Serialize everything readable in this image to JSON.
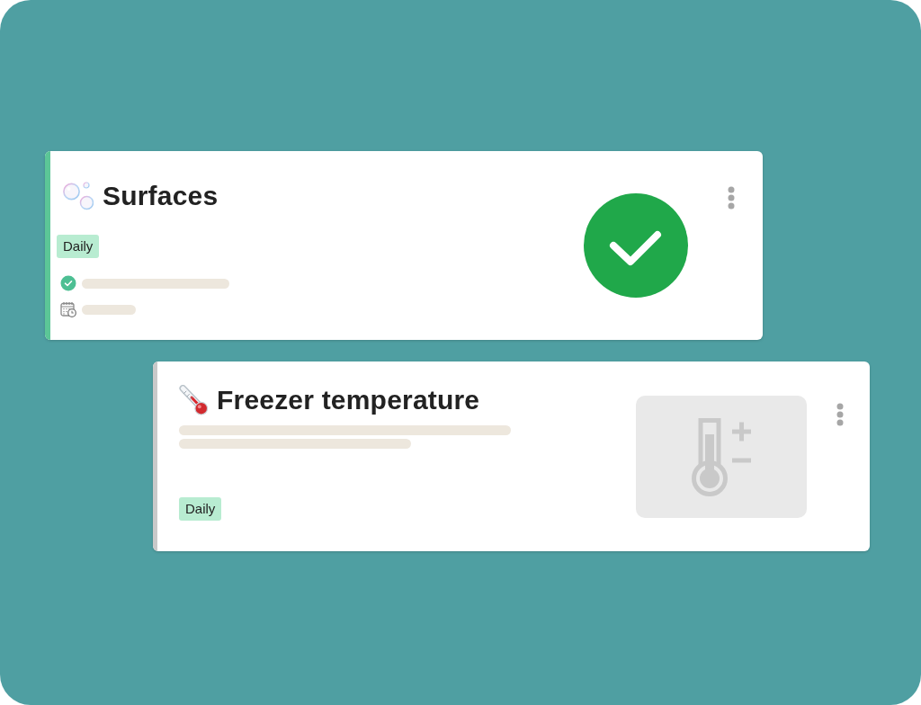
{
  "cards": [
    {
      "kind": "check",
      "title": "Surfaces",
      "color": "#5cc697",
      "tag": "Daily",
      "completed": true
    },
    {
      "kind": "temperature",
      "title": "Freezer temperature",
      "color": "#c9c9c9",
      "tag": "Daily",
      "completed": false
    }
  ]
}
